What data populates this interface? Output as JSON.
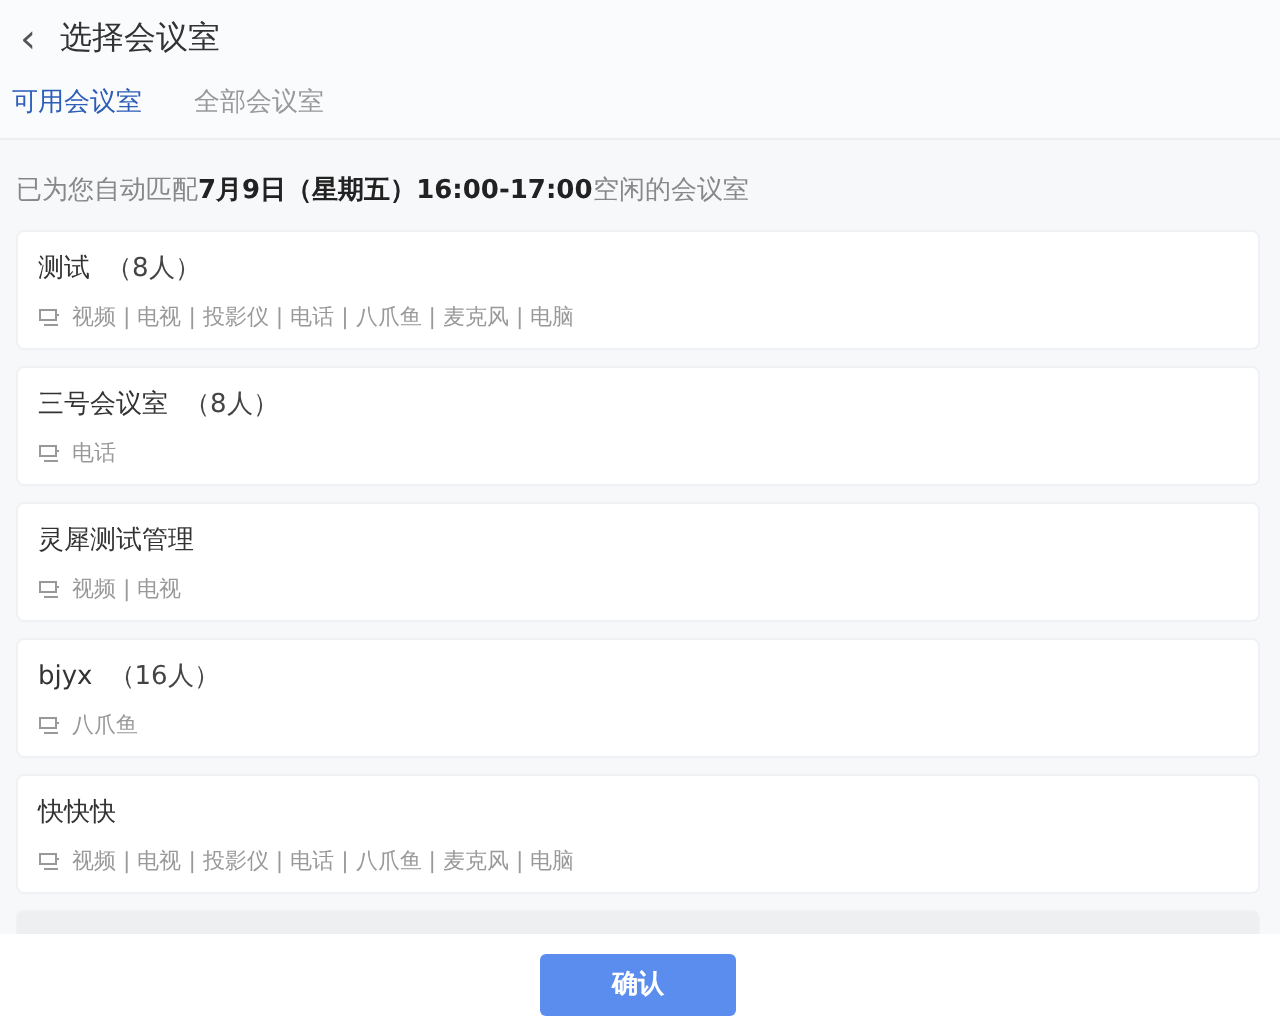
{
  "header": {
    "title": "选择会议室",
    "back_icon": "‹"
  },
  "tabs": [
    {
      "label": "可用会议室",
      "selected": true
    },
    {
      "label": "全部会议室",
      "selected": false
    }
  ],
  "notice": "已为您自动匹配**7月9日（星期五）16:00-17:00**空闲的会议室",
  "rooms": [
    {
      "name": "测试",
      "capacity": "（8人）",
      "facilities": "视频 | 电视 | 投影仪 | 电话 | 八爪鱼 | 麦克风 | 电脑",
      "disabled": false
    },
    {
      "name": "三号会议室",
      "capacity": "（8人）",
      "facilities": "电话",
      "disabled": false
    },
    {
      "name": "灵犀测试管理",
      "facilities": "视频 | 电视",
      "disabled": false
    },
    {
      "name": "bjyx",
      "capacity": "（16人）",
      "facilities": "八爪鱼",
      "disabled": false
    },
    {
      "name": "快快快",
      "facilities": "视频 | 电视 | 投影仪 | 电话 | 八爪鱼 | 麦克风 | 电脑",
      "disabled": false
    },
    {
      "disabled": true
    }
  ],
  "confirm_button": "确认"
}
